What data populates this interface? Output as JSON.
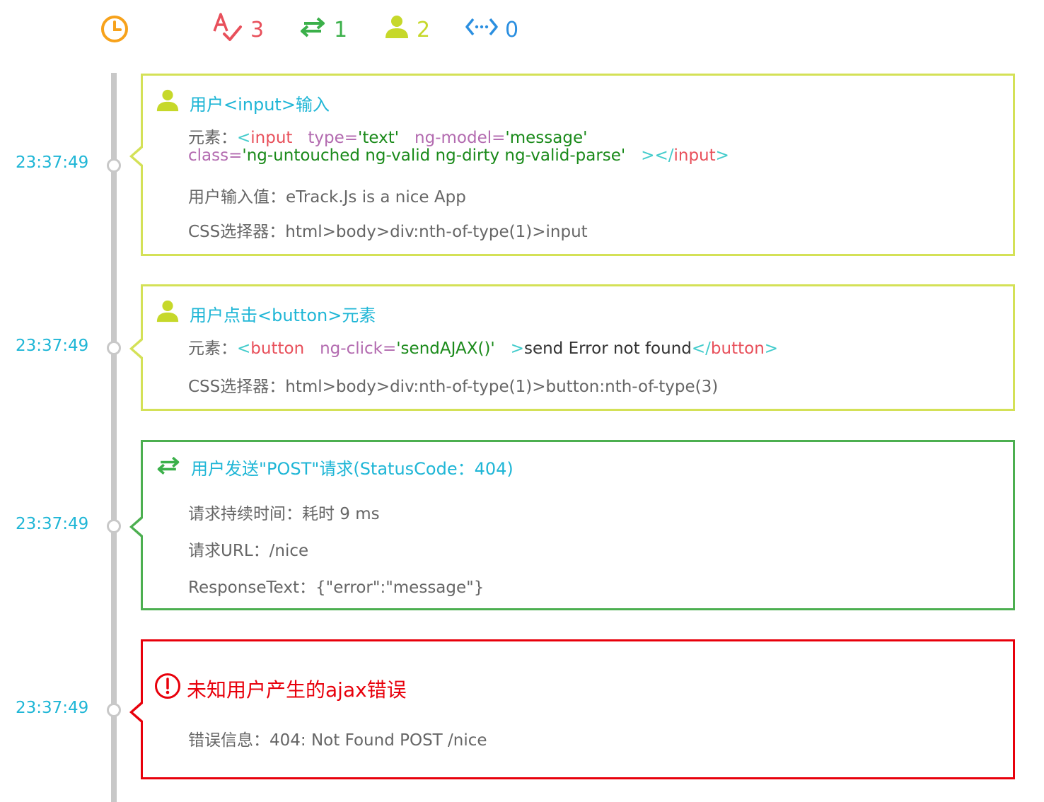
{
  "stats": {
    "error_count": "3",
    "ajax_count": "1",
    "user_count": "2",
    "code_count": "0"
  },
  "colors": {
    "user_card_border": "#d4e157",
    "ajax_card_border": "#4caf50",
    "error_card_border": "#e8000b",
    "time_color": "#1fb6d6"
  },
  "events": [
    {
      "time": "23:37:49",
      "title": "用户<input>输入",
      "element_label": "元素：",
      "html_open_lt": "<",
      "html_tag": "input",
      "attr_type": "type=",
      "attr_type_val": "'text'",
      "attr_model": "ng-model=",
      "attr_model_val": "'message'",
      "attr_class": "class=",
      "attr_class_val": "'ng-untouched ng-valid ng-dirty ng-valid-parse'",
      "html_close": "></",
      "html_close_tag": "input",
      "html_close_gt": ">",
      "value_line": "用户输入值：eTrack.Js is a nice App",
      "css_line": "CSS选择器：html>body>div:nth-of-type(1)>input"
    },
    {
      "time": "23:37:49",
      "title": "用户点击<button>元素",
      "element_label": "元素：",
      "html_open_lt": "<",
      "html_tag": "button",
      "attr_click": "ng-click=",
      "attr_click_val": "'sendAJAX()'",
      "html_gt": ">",
      "inner_text": "send Error not found",
      "html_close_lt": "</",
      "html_close_tag": "button",
      "html_close_gt": ">",
      "css_line": "CSS选择器：html>body>div:nth-of-type(1)>button:nth-of-type(3)"
    },
    {
      "time": "23:37:49",
      "title": "用户发送\"POST\"请求(StatusCode：404)",
      "duration_line": "请求持续时间：耗时 9 ms",
      "url_line": "请求URL：/nice",
      "response_line": "ResponseText：{\"error\":\"message\"}"
    },
    {
      "time": "23:37:49",
      "title": "未知用户产生的ajax错误",
      "error_line": "错误信息：404: Not Found POST /nice"
    }
  ]
}
